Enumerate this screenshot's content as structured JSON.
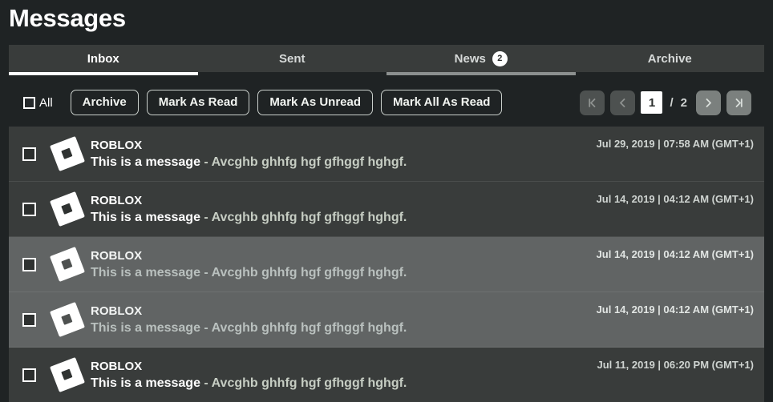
{
  "page": {
    "title": "Messages",
    "background_color": "#1f2324",
    "row_color": "#393c3b",
    "row_highlight_color": "#616464",
    "accent_color": "#ffffff"
  },
  "tabs": [
    {
      "label": "Inbox",
      "state": "active",
      "badge": ""
    },
    {
      "label": "Sent",
      "state": "normal",
      "badge": ""
    },
    {
      "label": "News",
      "state": "hovered",
      "badge": "2"
    },
    {
      "label": "Archive",
      "state": "normal",
      "badge": ""
    }
  ],
  "toolbar": {
    "select_all_label": "All",
    "select_all_checked": false,
    "buttons": [
      {
        "label": "Archive"
      },
      {
        "label": "Mark As Read"
      },
      {
        "label": "Mark As Unread"
      },
      {
        "label": "Mark All As Read"
      }
    ]
  },
  "pagination": {
    "first_icon": "first-page-icon",
    "prev_icon": "previous-page-icon",
    "next_icon": "next-page-icon",
    "last_icon": "last-page-icon",
    "current_page": "1",
    "separator": "/",
    "total_pages": "2",
    "first_enabled": false,
    "prev_enabled": false,
    "next_enabled": true,
    "last_enabled": true
  },
  "messages": [
    {
      "sender": "ROBLOX",
      "subject": "This is a message",
      "separator": " - ",
      "preview": "Avcghb ghhfg hgf gfhggf hghgf.",
      "date": "Jul 29, 2019 | 07:58 AM (GMT+1)",
      "checked": false,
      "read": false,
      "highlighted": false,
      "avatar_icon": "roblox-logo-icon"
    },
    {
      "sender": "ROBLOX",
      "subject": "This is a message",
      "separator": " - ",
      "preview": "Avcghb ghhfg hgf gfhggf hghgf.",
      "date": "Jul 14, 2019 | 04:12 AM (GMT+1)",
      "checked": false,
      "read": false,
      "highlighted": false,
      "avatar_icon": "roblox-logo-icon"
    },
    {
      "sender": "ROBLOX",
      "subject": "This is a message",
      "separator": " - ",
      "preview": "Avcghb ghhfg hgf gfhggf hghgf.",
      "date": "Jul 14, 2019 | 04:12 AM (GMT+1)",
      "checked": false,
      "read": true,
      "highlighted": true,
      "avatar_icon": "roblox-logo-icon"
    },
    {
      "sender": "ROBLOX",
      "subject": "This is a message",
      "separator": " - ",
      "preview": "Avcghb ghhfg hgf gfhggf hghgf.",
      "date": "Jul 14, 2019 | 04:12 AM (GMT+1)",
      "checked": false,
      "read": true,
      "highlighted": true,
      "avatar_icon": "roblox-logo-icon"
    },
    {
      "sender": "ROBLOX",
      "subject": "This is a message",
      "separator": " - ",
      "preview": "Avcghb ghhfg hgf gfhggf hghgf.",
      "date": "Jul 11, 2019 | 06:20 PM (GMT+1)",
      "checked": false,
      "read": false,
      "highlighted": false,
      "avatar_icon": "roblox-logo-icon"
    }
  ]
}
